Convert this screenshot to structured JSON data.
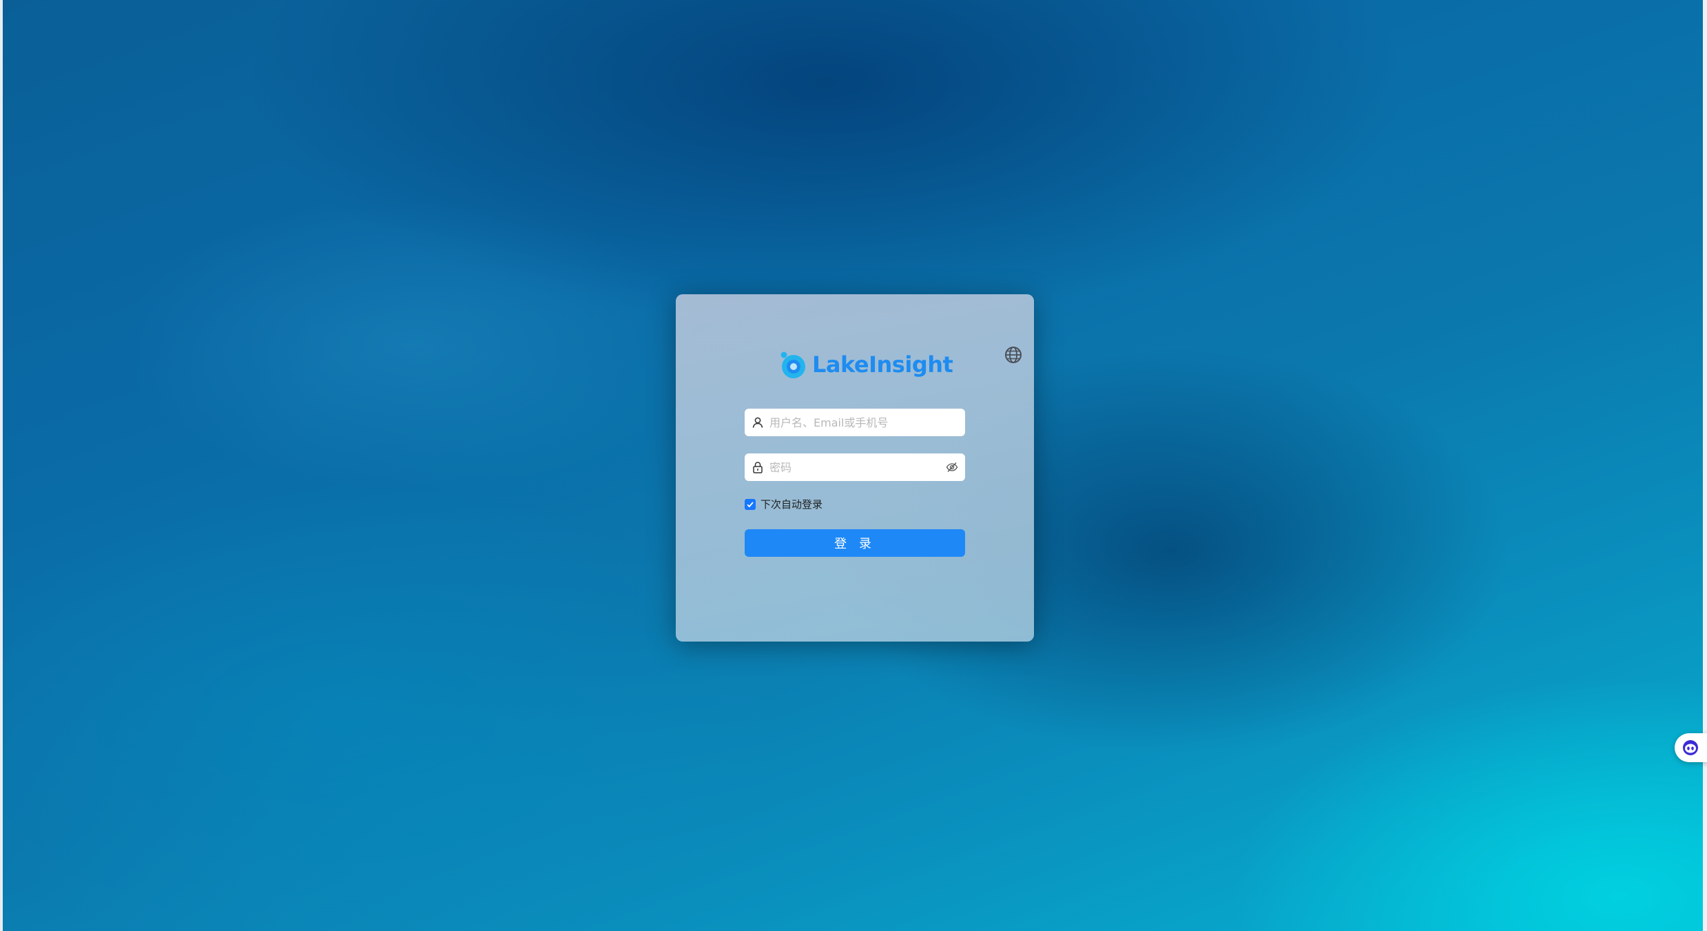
{
  "app": {
    "logo_text": "LakeInsight",
    "brand_color": "#1e8cf0",
    "background": "ocean-water-photo"
  },
  "login": {
    "username_placeholder": "用户名、Email或手机号",
    "password_placeholder": "密码",
    "remember_label": "下次自动登录",
    "remember_checked": true,
    "submit_label": "登 录",
    "submit_color": "#1e88f7"
  },
  "icons": {
    "language": "globe-icon",
    "username": "user-icon",
    "password": "lock-icon",
    "toggle_password": "eye-slash-icon",
    "assistant": "robot-icon"
  }
}
